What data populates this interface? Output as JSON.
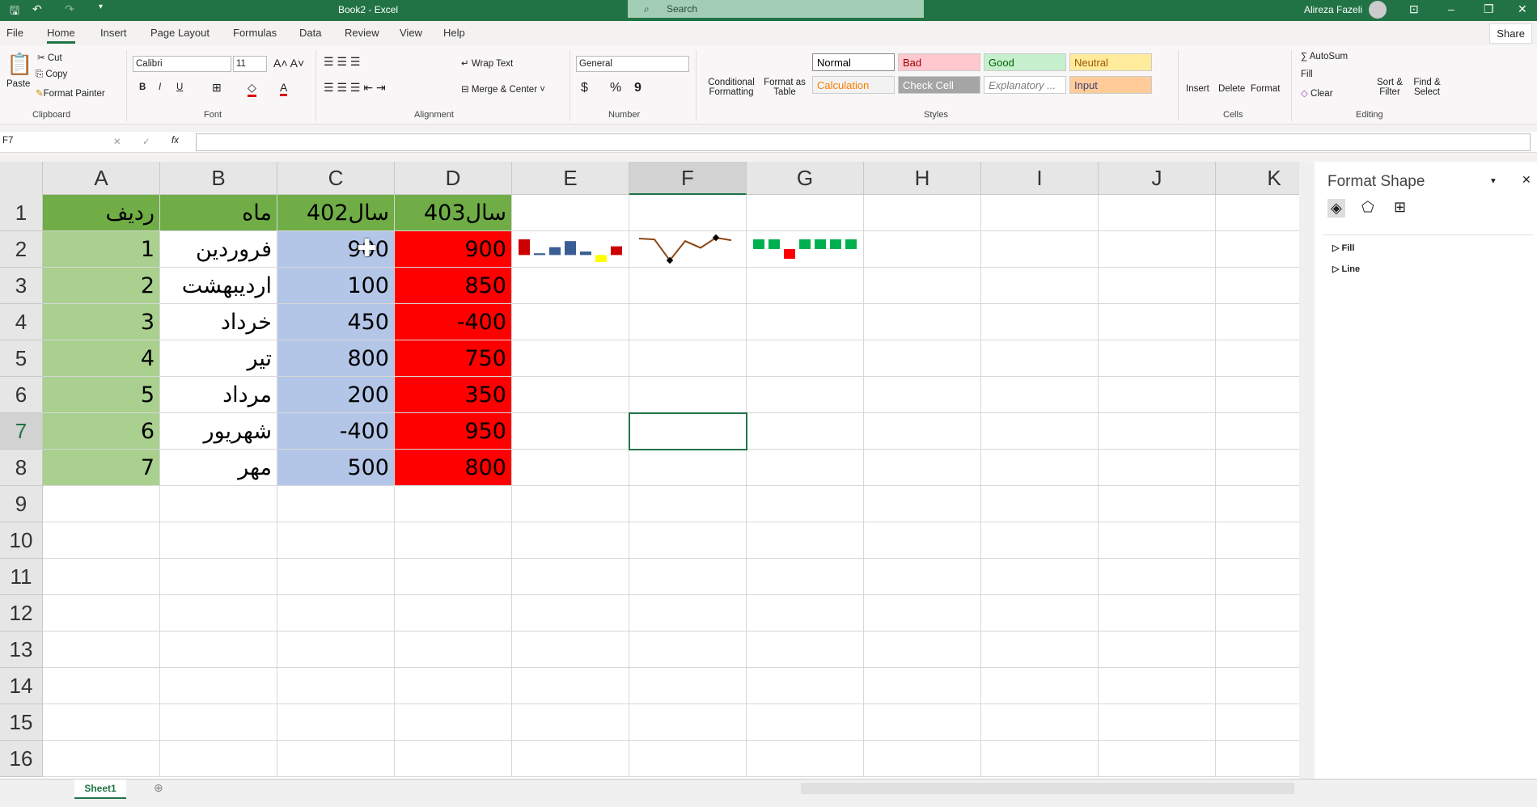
{
  "window": {
    "title": "Book2 - Excel",
    "search_placeholder": "Search",
    "user": "Alireza Fazeli"
  },
  "tabs": [
    "File",
    "Home",
    "Insert",
    "Page Layout",
    "Formulas",
    "Data",
    "Review",
    "View",
    "Help"
  ],
  "active_tab": "Home",
  "share": "Share",
  "ribbon": {
    "clipboard": {
      "paste": "Paste",
      "cut": "Cut",
      "copy": "Copy",
      "format_painter": "Format Painter",
      "label": "Clipboard"
    },
    "font": {
      "name": "Calibri",
      "size": "11",
      "bold": "B",
      "italic": "I",
      "underline": "U",
      "label": "Font"
    },
    "alignment": {
      "wrap": "Wrap Text",
      "merge": "Merge & Center",
      "label": "Alignment"
    },
    "number": {
      "format": "General",
      "currency": "$",
      "percent": "%",
      "comma": "9",
      "label": "Number"
    },
    "styles": {
      "conditional": "Conditional Formatting",
      "format_table": "Format as Table",
      "items": [
        {
          "label": "Normal",
          "bg": "#ffffff",
          "fg": "#000000"
        },
        {
          "label": "Bad",
          "bg": "#ffc7ce",
          "fg": "#9c0006"
        },
        {
          "label": "Good",
          "bg": "#c6efce",
          "fg": "#006100"
        },
        {
          "label": "Neutral",
          "bg": "#ffeb9c",
          "fg": "#9c5700"
        },
        {
          "label": "Calculation",
          "bg": "#f2f2f2",
          "fg": "#fa7d00"
        },
        {
          "label": "Check Cell",
          "bg": "#a5a5a5",
          "fg": "#ffffff"
        },
        {
          "label": "Explanatory ...",
          "bg": "#ffffff",
          "fg": "#7f7f7f"
        },
        {
          "label": "Input",
          "bg": "#ffcc99",
          "fg": "#3f3f76"
        }
      ],
      "label": "Styles"
    },
    "cells": {
      "insert": "Insert",
      "delete": "Delete",
      "format": "Format",
      "label": "Cells"
    },
    "editing": {
      "autosum": "AutoSum",
      "fill": "Fill",
      "clear": "Clear",
      "sort": "Sort & Filter",
      "find": "Find & Select",
      "label": "Editing"
    }
  },
  "formula_bar": {
    "name_box": "F7",
    "fx": "fx",
    "value": ""
  },
  "columns": [
    "A",
    "B",
    "C",
    "D",
    "E",
    "F",
    "G",
    "H",
    "I",
    "J",
    "K"
  ],
  "selected_col": "F",
  "selected_row": 7,
  "rows": [
    1,
    2,
    3,
    4,
    5,
    6,
    7,
    8,
    9,
    10,
    11,
    12,
    13,
    14,
    15,
    16
  ],
  "table": {
    "header": [
      "ردیف",
      "ماه",
      "سال402",
      "سال403"
    ],
    "data": [
      [
        "1",
        "فروردین",
        "900",
        "900"
      ],
      [
        "2",
        "اردیبهشت",
        "100",
        "850"
      ],
      [
        "3",
        "خرداد",
        "450",
        "-400"
      ],
      [
        "4",
        "تیر",
        "800",
        "750"
      ],
      [
        "5",
        "مرداد",
        "200",
        "350"
      ],
      [
        "6",
        "شهریور",
        "-400",
        "950"
      ],
      [
        "7",
        "مهر",
        "500",
        "800"
      ]
    ]
  },
  "colors": {
    "header_green": "#70ad47",
    "col_a": "#a9d08e",
    "col_c": "#b4c6e7",
    "col_d": "#ff0000",
    "accent": "#217346"
  },
  "sparklines": {
    "column": {
      "values": [
        900,
        100,
        450,
        800,
        200,
        -400,
        500
      ],
      "color": "#3a5e94",
      "high_color": "#cc0000",
      "last_color": "#cc0000",
      "negative_color": "#ffff00"
    },
    "line": {
      "values": [
        900,
        850,
        -400,
        750,
        350,
        950,
        800
      ],
      "color": "#8b4513",
      "marker_color": "#000000"
    },
    "win_loss": {
      "values": [
        900,
        850,
        -400,
        750,
        350,
        950,
        800
      ],
      "positive_color": "#00b050",
      "negative_color": "#ff0000"
    }
  },
  "format_pane": {
    "title": "Format Shape",
    "sections": [
      "Fill",
      "Line"
    ]
  },
  "sheets": [
    "Sheet1"
  ]
}
